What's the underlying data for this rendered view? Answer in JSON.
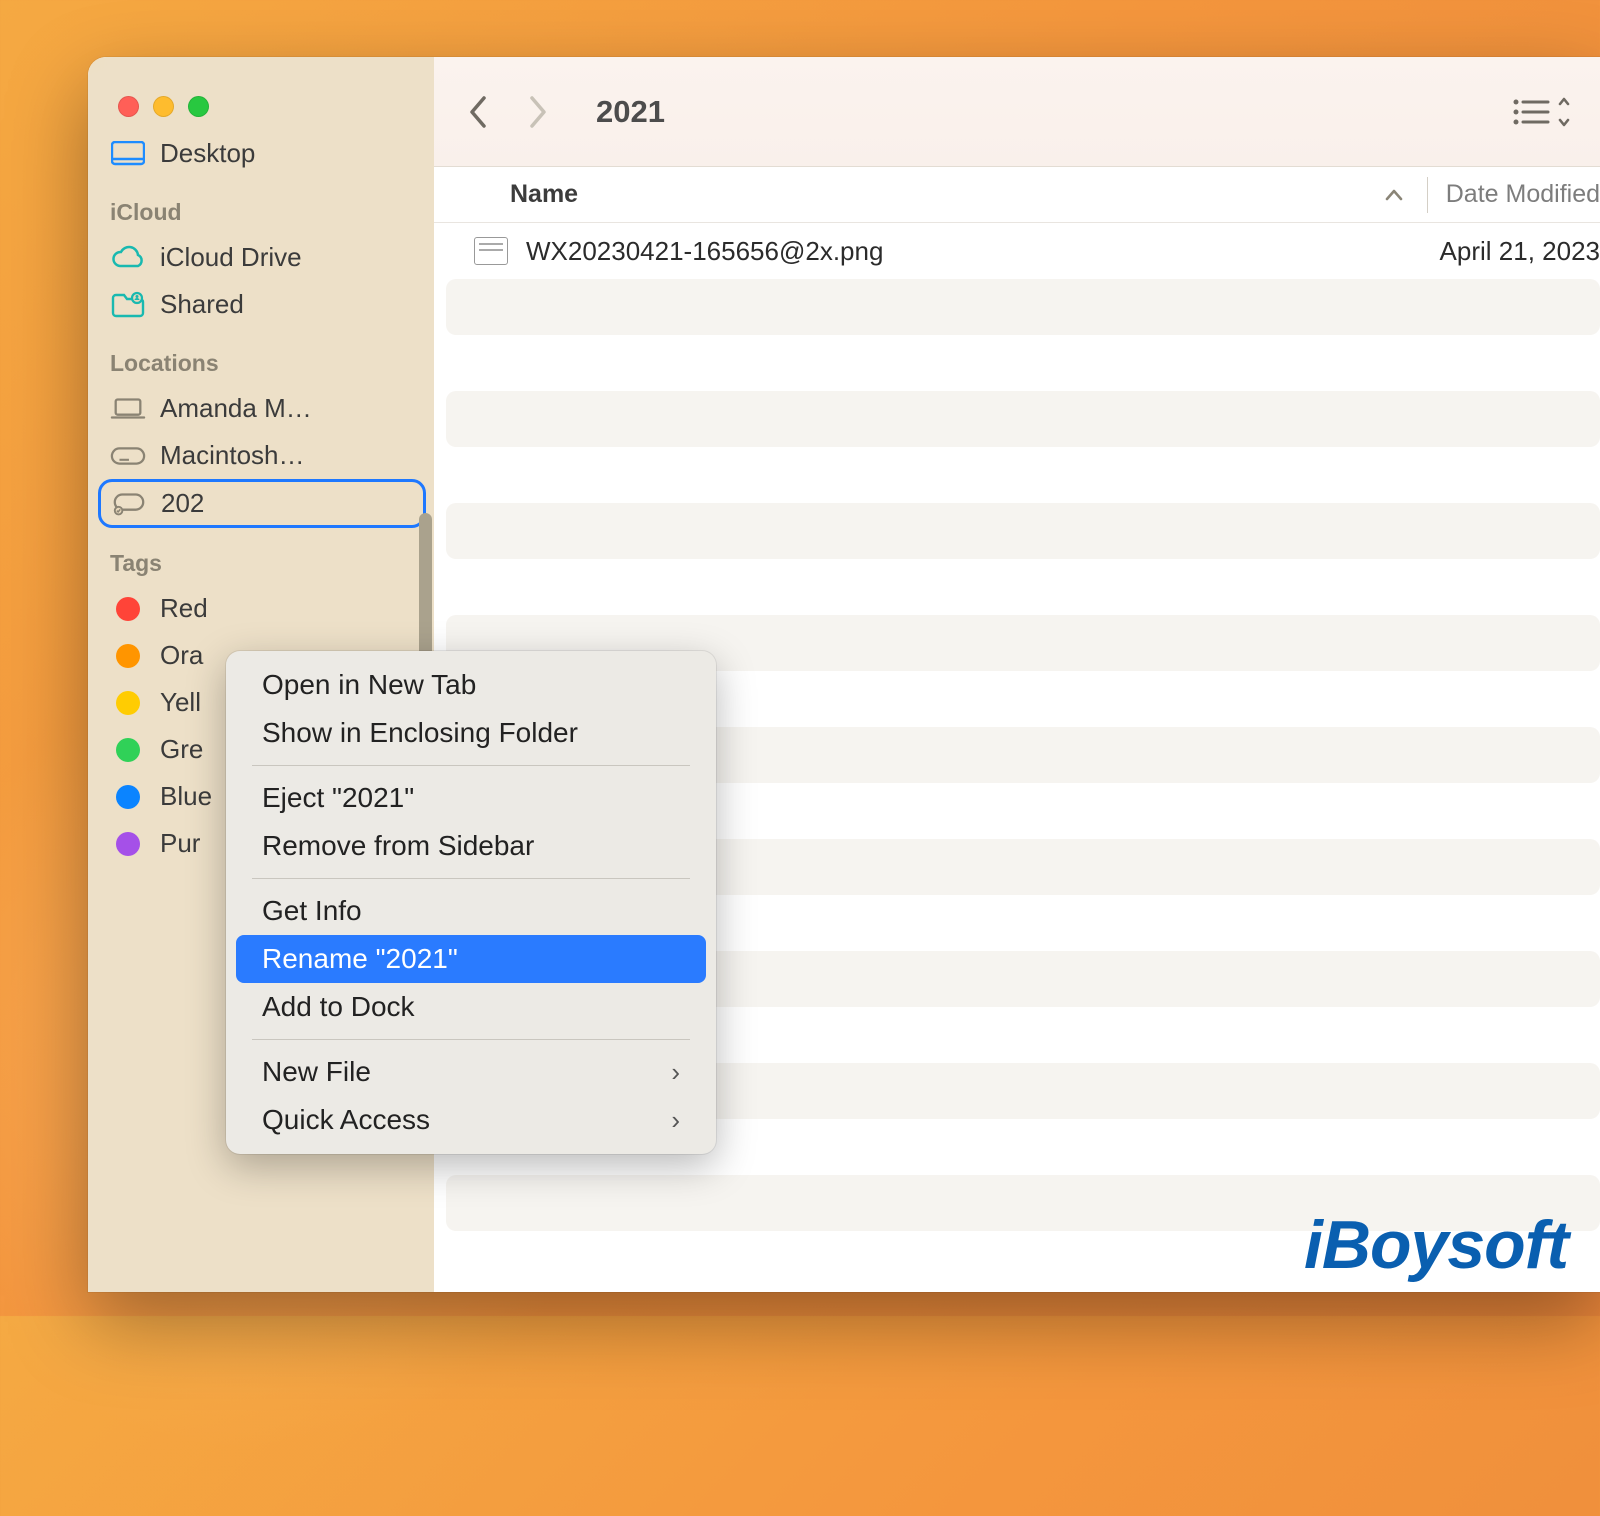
{
  "window": {
    "title": "2021"
  },
  "sidebar": {
    "desktop_label": "Desktop",
    "sections": {
      "icloud": {
        "header": "iCloud",
        "icloud_drive": "iCloud Drive",
        "shared": "Shared"
      },
      "locations": {
        "header": "Locations",
        "amanda": "Amanda M…",
        "macintosh": "Macintosh…",
        "disk_2021": "202"
      },
      "tags": {
        "header": "Tags",
        "items": [
          {
            "label": "Red",
            "color": "#ff4438"
          },
          {
            "label": "Ora",
            "color": "#ff9500"
          },
          {
            "label": "Yell",
            "color": "#ffcc02"
          },
          {
            "label": "Gre",
            "color": "#30d158"
          },
          {
            "label": "Blue",
            "color": "#0b84ff"
          },
          {
            "label": "Pur",
            "color": "#a550e8"
          }
        ]
      }
    }
  },
  "columns": {
    "name": "Name",
    "date_modified": "Date Modified"
  },
  "files": [
    {
      "name": "WX20230421-165656@2x.png",
      "date": "April 21, 2023"
    }
  ],
  "context_menu": {
    "open_new_tab": "Open in New Tab",
    "show_enclosing": "Show in Enclosing Folder",
    "eject": "Eject \"2021\"",
    "remove_sidebar": "Remove from Sidebar",
    "get_info": "Get Info",
    "rename": "Rename \"2021\"",
    "add_to_dock": "Add to Dock",
    "new_file": "New File",
    "quick_access": "Quick Access"
  },
  "watermark": "iBoysoft"
}
